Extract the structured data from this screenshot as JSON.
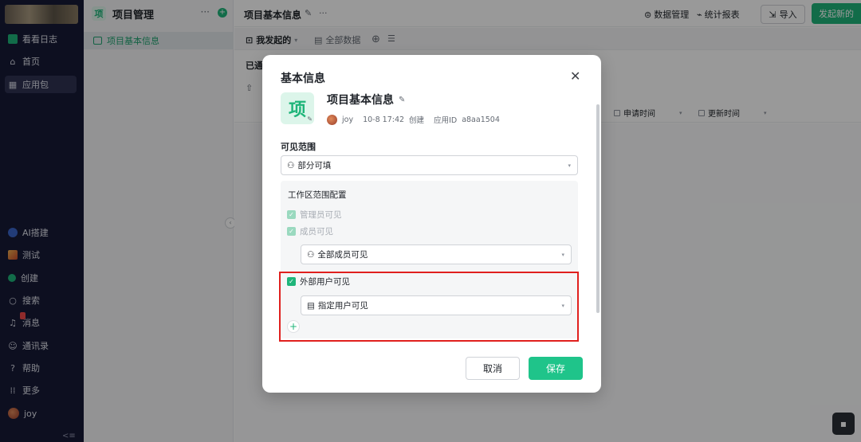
{
  "sidebar": {
    "items": [
      {
        "label": "看看日志",
        "icon": "logbook-icon"
      },
      {
        "label": "首页",
        "icon": "home-icon"
      },
      {
        "label": "应用包",
        "icon": "app-grid-icon"
      },
      {
        "label": "AI搭建",
        "icon": "ai-icon"
      },
      {
        "label": "测试",
        "icon": "test-app-icon"
      },
      {
        "label": "创建",
        "icon": "create-icon"
      },
      {
        "label": "搜索",
        "icon": "search-icon"
      },
      {
        "label": "消息",
        "icon": "bell-icon"
      },
      {
        "label": "通讯录",
        "icon": "contacts-icon"
      },
      {
        "label": "帮助",
        "icon": "help-icon"
      },
      {
        "label": "更多",
        "icon": "more-grid-icon"
      },
      {
        "label": "joy",
        "icon": "avatar"
      }
    ]
  },
  "panel": {
    "logo": "项",
    "title": "项目管理",
    "item": "项目基本信息"
  },
  "topbar": {
    "title": "项目基本信息",
    "data_manage": "数据管理",
    "stats_report": "统计报表",
    "import": "导入",
    "new": "发起新的"
  },
  "tabs": {
    "mine": "我发起的",
    "all": "全部数据"
  },
  "filter": {
    "label": "已通"
  },
  "table": {
    "headers": [
      "申请时间",
      "更新时间"
    ]
  },
  "modal": {
    "title": "基本信息",
    "app_icon_char": "项",
    "app_name": "项目基本信息",
    "creator": "joy",
    "created_time": "10-8 17:42",
    "created_label": "创建",
    "app_id_label": "应用ID",
    "app_id": "a8aa1504",
    "visibility_label": "可见范围",
    "visibility_value": "部分可填",
    "workspace_config_title": "工作区范围配置",
    "admin_visible": "管理员可见",
    "member_visible": "成员可见",
    "member_scope_value": "全部成员可见",
    "external_visible": "外部用户可见",
    "external_scope_value": "指定用户可见",
    "cancel": "取消",
    "save": "保存"
  },
  "colors": {
    "accent": "#1fb57a",
    "save_button": "#1fc48a",
    "highlight_border": "#e0201e",
    "sidebar_bg": "#171a36"
  }
}
